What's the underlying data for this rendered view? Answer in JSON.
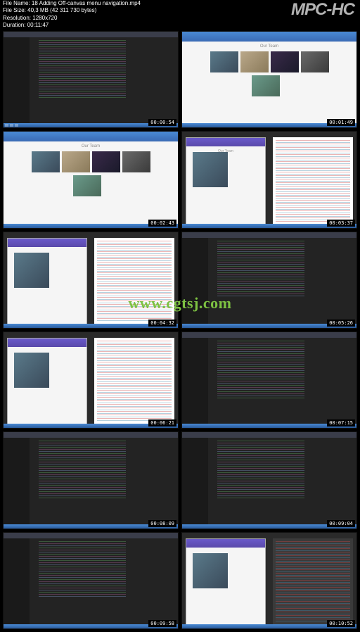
{
  "player": {
    "name": "MPC-HC"
  },
  "info": {
    "filename_label": "File Name:",
    "filename": "18 Adding Off-canvas menu navigation.mp4",
    "filesize_label": "File Size:",
    "filesize": "40,3 MB (42 311 730 bytes)",
    "resolution_label": "Resolution:",
    "resolution": "1280x720",
    "duration_label": "Duration:",
    "duration": "00:11:47"
  },
  "watermark": "www.cgtsj.com",
  "page_titles": {
    "our_team": "Our Team"
  },
  "thumbnails": [
    {
      "timestamp": "00:00:54",
      "type": "editor"
    },
    {
      "timestamp": "00:01:49",
      "type": "team"
    },
    {
      "timestamp": "00:02:43",
      "type": "team"
    },
    {
      "timestamp": "00:03:37",
      "type": "split"
    },
    {
      "timestamp": "00:04:32",
      "type": "split"
    },
    {
      "timestamp": "00:05:26",
      "type": "editor"
    },
    {
      "timestamp": "00:06:21",
      "type": "split"
    },
    {
      "timestamp": "00:07:15",
      "type": "editor"
    },
    {
      "timestamp": "00:08:09",
      "type": "editor"
    },
    {
      "timestamp": "00:09:04",
      "type": "editor"
    },
    {
      "timestamp": "00:09:58",
      "type": "editor"
    },
    {
      "timestamp": "00:10:52",
      "type": "split"
    }
  ]
}
